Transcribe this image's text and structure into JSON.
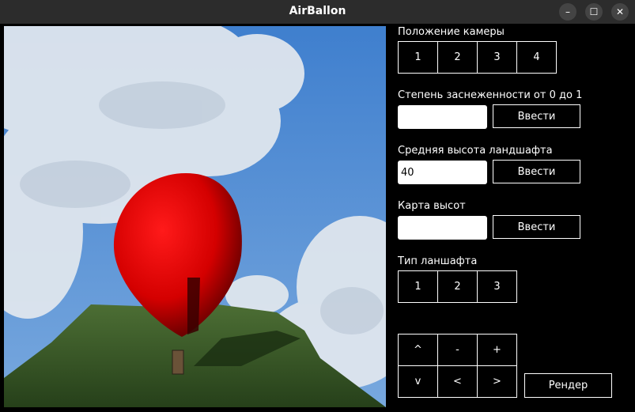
{
  "window": {
    "title": "AirBallon"
  },
  "titlebar_buttons": {
    "minimize": "–",
    "maximize": "☐",
    "close": "✕"
  },
  "panel": {
    "camera": {
      "label": "Положение камеры",
      "options": [
        "1",
        "2",
        "3",
        "4"
      ]
    },
    "snow": {
      "label": "Степень заснеженности от 0 до 1",
      "value": "",
      "button": "Ввести"
    },
    "height": {
      "label": "Средняя высота ландшафта",
      "value": "40",
      "button": "Ввести"
    },
    "heightmap": {
      "label": "Карта высот",
      "value": "",
      "button": "Ввести"
    },
    "landscape_type": {
      "label": "Тип ланшафта",
      "options": [
        "1",
        "2",
        "3"
      ]
    },
    "controls": {
      "up": "^",
      "minus": "-",
      "plus": "+",
      "down": "v",
      "left": "<",
      "right": ">"
    },
    "render_button": "Рендер"
  },
  "colors": {
    "sky": "#5a8fd0",
    "balloon": "#e00000",
    "grass": "#3a5a28",
    "titlebar": "#2c2c2c"
  }
}
